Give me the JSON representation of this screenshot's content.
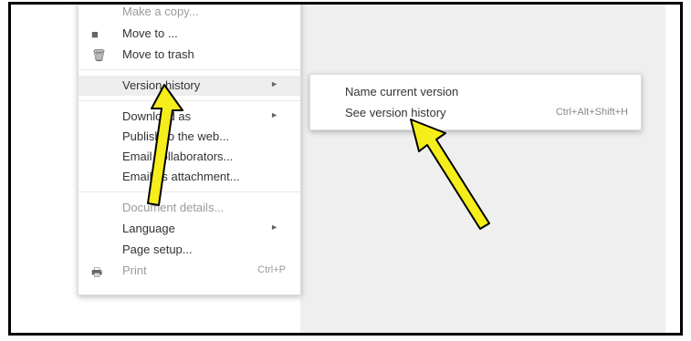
{
  "file_menu": {
    "items": [
      {
        "label": "Make a copy..."
      },
      {
        "label": "Move to ...",
        "icon": "folder-icon"
      },
      {
        "label": "Move to trash",
        "icon": "trash-icon"
      },
      {
        "label": "Version history",
        "arrow": "►"
      },
      {
        "label": "Download as",
        "arrow": "►"
      },
      {
        "label": "Publish to the web..."
      },
      {
        "label": "Email collaborators..."
      },
      {
        "label": "Email as attachment..."
      },
      {
        "label": "Document details..."
      },
      {
        "label": "Language",
        "arrow": "►"
      },
      {
        "label": "Page setup..."
      },
      {
        "label": "Print",
        "icon": "printer-icon",
        "shortcut": "Ctrl+P"
      }
    ]
  },
  "submenu": {
    "items": [
      {
        "label": "Name current version"
      },
      {
        "label": "See version history",
        "shortcut": "Ctrl+Alt+Shift+H"
      }
    ]
  },
  "annotation": {
    "arrow_color": "#f5ee1a",
    "arrow_count": 2
  }
}
